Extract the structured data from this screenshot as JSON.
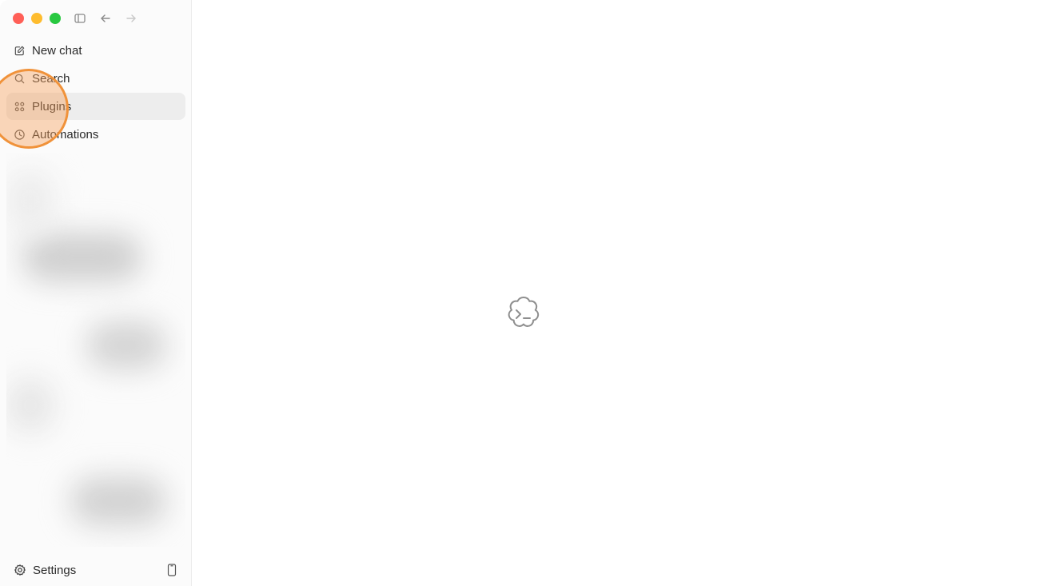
{
  "window": {
    "controls": [
      "close",
      "minimize",
      "maximize"
    ],
    "colors": {
      "close": "#ff5f57",
      "minimize": "#febc2e",
      "maximize": "#28c840"
    }
  },
  "toolbar": {
    "icons": [
      "sidebar-toggle-icon",
      "arrow-left-icon",
      "arrow-right-icon"
    ]
  },
  "sidebar": {
    "items": [
      {
        "label": "New chat",
        "icon": "edit-icon"
      },
      {
        "label": "Search",
        "icon": "search-icon"
      },
      {
        "label": "Plugins",
        "icon": "grid-icon",
        "active": true
      },
      {
        "label": "Automations",
        "icon": "clock-icon"
      }
    ],
    "settings_label": "Settings"
  },
  "main": {
    "loader_icon": "terminal-cloud-icon"
  },
  "highlight_color": "#f0923a"
}
